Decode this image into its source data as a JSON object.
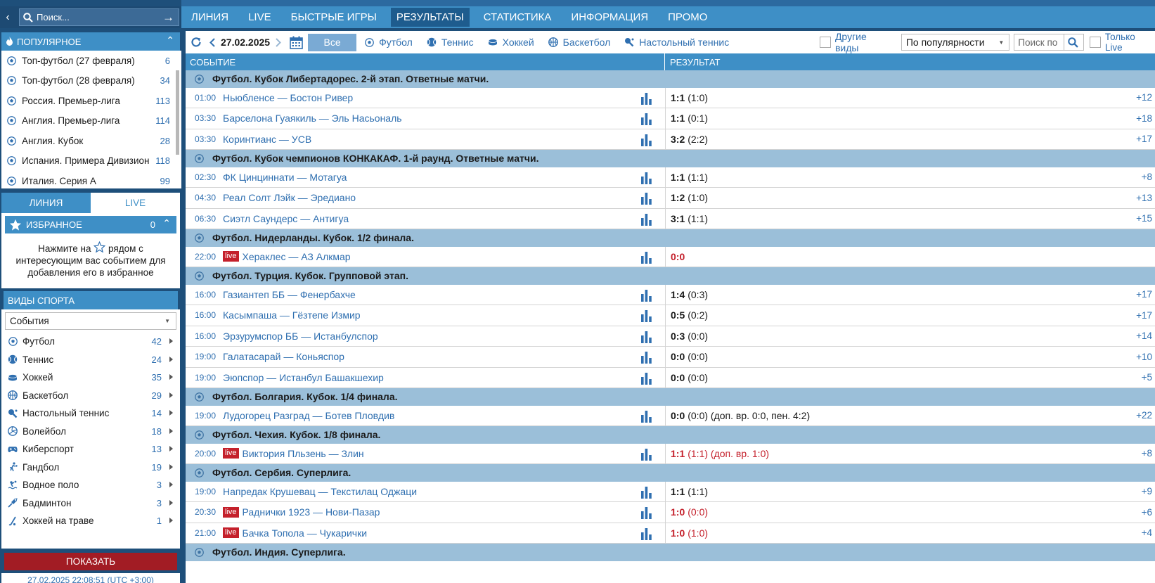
{
  "search": {
    "placeholder": "Поиск..."
  },
  "nav": {
    "items": [
      "ЛИНИЯ",
      "LIVE",
      "БЫСТРЫЕ ИГРЫ",
      "РЕЗУЛЬТАТЫ",
      "СТАТИСТИКА",
      "ИНФОРМАЦИЯ",
      "ПРОМО"
    ],
    "active": "РЕЗУЛЬТАТЫ"
  },
  "popular": {
    "title": "ПОПУЛЯРНОЕ",
    "items": [
      {
        "name": "Топ-футбол (27 февраля)",
        "count": "6"
      },
      {
        "name": "Топ-футбол (28 февраля)",
        "count": "34"
      },
      {
        "name": "Россия. Премьер-лига",
        "count": "113"
      },
      {
        "name": "Англия. Премьер-лига",
        "count": "114"
      },
      {
        "name": "Англия. Кубок",
        "count": "28"
      },
      {
        "name": "Испания. Примера Дивизион",
        "count": "118"
      },
      {
        "name": "Италия. Серия А",
        "count": "99"
      }
    ]
  },
  "tabs": {
    "line": "ЛИНИЯ",
    "live": "LIVE"
  },
  "favorites": {
    "title": "ИЗБРАННОЕ",
    "count": "0",
    "hint_before": "Нажмите на",
    "hint_after": "рядом с интересующим вас событием для добавления его в избранное"
  },
  "sports": {
    "title": "ВИДЫ СПОРТА",
    "select_value": "События",
    "items": [
      {
        "name": "Футбол",
        "count": "42",
        "icon": "football-icon"
      },
      {
        "name": "Теннис",
        "count": "24",
        "icon": "tennis-icon"
      },
      {
        "name": "Хоккей",
        "count": "35",
        "icon": "hockey-icon"
      },
      {
        "name": "Баскетбол",
        "count": "29",
        "icon": "basketball-icon"
      },
      {
        "name": "Настольный теннис",
        "count": "14",
        "icon": "table-tennis-icon"
      },
      {
        "name": "Волейбол",
        "count": "18",
        "icon": "volleyball-icon"
      },
      {
        "name": "Киберспорт",
        "count": "13",
        "icon": "gamepad-icon"
      },
      {
        "name": "Гандбол",
        "count": "19",
        "icon": "handball-icon"
      },
      {
        "name": "Водное поло",
        "count": "3",
        "icon": "water-polo-icon"
      },
      {
        "name": "Бадминтон",
        "count": "3",
        "icon": "badminton-icon"
      },
      {
        "name": "Хоккей на траве",
        "count": "1",
        "icon": "field-hockey-icon"
      }
    ],
    "show_button": "ПОКАЗАТЬ",
    "timestamp": "27.02.2025 22:08:51 (UTC +3:00)"
  },
  "filter": {
    "date": "27.02.2025",
    "all": "Все",
    "sports": [
      {
        "name": "Футбол",
        "icon": "football-icon"
      },
      {
        "name": "Теннис",
        "icon": "tennis-icon"
      },
      {
        "name": "Хоккей",
        "icon": "hockey-icon"
      },
      {
        "name": "Баскетбол",
        "icon": "basketball-icon"
      },
      {
        "name": "Настольный теннис",
        "icon": "table-tennis-icon"
      }
    ],
    "other": "Другие виды",
    "sort": "По популярности",
    "search_placeholder": "Поиск по",
    "only_live": "Только Live"
  },
  "table": {
    "col_event": "СОБЫТИЕ",
    "col_result": "РЕЗУЛЬТАТ",
    "groups": [
      {
        "title": "Футбол. Кубок Либертадорес. 2-й этап. Ответные матчи.",
        "rows": [
          {
            "time": "01:00",
            "live": false,
            "event": "Ньюбленсе — Бостон Ривер",
            "score": "1:1",
            "detail": "(1:0)",
            "plus": "+12"
          },
          {
            "time": "03:30",
            "live": false,
            "event": "Барселона Гуаякиль — Эль Насьональ",
            "score": "1:1",
            "detail": "(0:1)",
            "plus": "+18"
          },
          {
            "time": "03:30",
            "live": false,
            "event": "Коринтианс — УСВ",
            "score": "3:2",
            "detail": "(2:2)",
            "plus": "+17"
          }
        ]
      },
      {
        "title": "Футбол. Кубок чемпионов КОНКАКАФ. 1-й раунд. Ответные матчи.",
        "rows": [
          {
            "time": "02:30",
            "live": false,
            "event": "ФК Цинциннати — Мотагуа",
            "score": "1:1",
            "detail": "(1:1)",
            "plus": "+8"
          },
          {
            "time": "04:30",
            "live": false,
            "event": "Реал Солт Лэйк — Эредиано",
            "score": "1:2",
            "detail": "(1:0)",
            "plus": "+13"
          },
          {
            "time": "06:30",
            "live": false,
            "event": "Сиэтл Саундерс — Антигуа",
            "score": "3:1",
            "detail": "(1:1)",
            "plus": "+15"
          }
        ]
      },
      {
        "title": "Футбол. Нидерланды. Кубок. 1/2 финала.",
        "rows": [
          {
            "time": "22:00",
            "live": true,
            "event": "Хераклес — АЗ Алкмар",
            "score": "0:0",
            "detail": "",
            "plus": ""
          }
        ]
      },
      {
        "title": "Футбол. Турция. Кубок. Групповой этап.",
        "rows": [
          {
            "time": "16:00",
            "live": false,
            "event": "Газиантеп ББ — Фенербахче",
            "score": "1:4",
            "detail": "(0:3)",
            "plus": "+17"
          },
          {
            "time": "16:00",
            "live": false,
            "event": "Касымпаша — Гёзтепе Измир",
            "score": "0:5",
            "detail": "(0:2)",
            "plus": "+17"
          },
          {
            "time": "16:00",
            "live": false,
            "event": "Эрзурумспор ББ — Истанбулспор",
            "score": "0:3",
            "detail": "(0:0)",
            "plus": "+14"
          },
          {
            "time": "19:00",
            "live": false,
            "event": "Галатасарай — Коньяспор",
            "score": "0:0",
            "detail": "(0:0)",
            "plus": "+10"
          },
          {
            "time": "19:00",
            "live": false,
            "event": "Эюпспор — Истанбул Башакшехир",
            "score": "0:0",
            "detail": "(0:0)",
            "plus": "+5"
          }
        ]
      },
      {
        "title": "Футбол. Болгария. Кубок. 1/4 финала.",
        "rows": [
          {
            "time": "19:00",
            "live": false,
            "event": "Лудогорец Разград — Ботев Пловдив",
            "score": "0:0",
            "detail": "(0:0) (доп. вр. 0:0, пен. 4:2)",
            "plus": "+22"
          }
        ]
      },
      {
        "title": "Футбол. Чехия. Кубок. 1/8 финала.",
        "rows": [
          {
            "time": "20:00",
            "live": true,
            "event": "Виктория Пльзень — Злин",
            "score": "1:1",
            "detail": "(1:1) (доп. вр. 1:0)",
            "plus": "+8"
          }
        ]
      },
      {
        "title": "Футбол. Сербия. Суперлига.",
        "rows": [
          {
            "time": "19:00",
            "live": false,
            "event": "Напредак Крушевац — Текстилац Оджаци",
            "score": "1:1",
            "detail": "(1:1)",
            "plus": "+9"
          },
          {
            "time": "20:30",
            "live": true,
            "event": "Раднички 1923 — Нови-Пазар",
            "score": "1:0",
            "detail": "(0:0)",
            "plus": "+6"
          },
          {
            "time": "21:00",
            "live": true,
            "event": "Бачка Топола — Чукарички",
            "score": "1:0",
            "detail": "(1:0)",
            "plus": "+4"
          }
        ]
      },
      {
        "title": "Футбол. Индия. Суперлига.",
        "rows": []
      }
    ],
    "live_label": "live"
  },
  "colors": {
    "accent": "#3e8fc6",
    "dark": "#1e4f7a",
    "group_bg": "#9bbfd9",
    "live_red": "#c4202b",
    "link_blue": "#2f6fb0"
  }
}
